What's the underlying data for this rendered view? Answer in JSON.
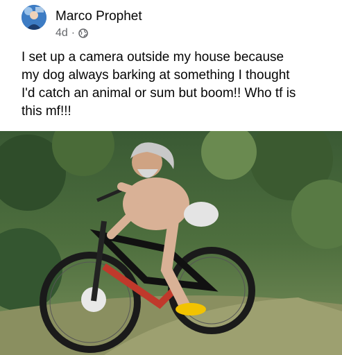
{
  "post": {
    "author": "Marco Prophet",
    "timestamp": "4d",
    "separator": "·",
    "privacy_icon": "globe-icon",
    "text": "I set up a camera outside my house because\nmy dog always barking at something I thought\nI'd catch an animal or sum but boom!! Who tf is\nthis mf!!!"
  },
  "colors": {
    "text_primary": "#050505",
    "text_secondary": "#65676b",
    "background": "#ffffff"
  }
}
